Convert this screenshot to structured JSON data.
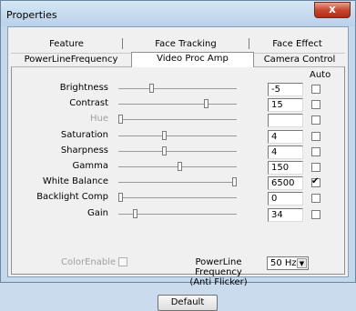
{
  "window": {
    "title": "Properties",
    "close_glyph": "x"
  },
  "tabs_row1": [
    "Feature",
    "Face Tracking",
    "Face Effect"
  ],
  "tabs_row2": [
    "PowerLineFrequency",
    "Video Proc Amp",
    "Camera Control"
  ],
  "active_tab": "Video Proc Amp",
  "auto_header": "Auto",
  "controls": [
    {
      "label": "Brightness",
      "value": "-5",
      "level": 0.27,
      "auto": false,
      "enabled": true
    },
    {
      "label": "Contrast",
      "value": "15",
      "level": 0.75,
      "auto": false,
      "enabled": true
    },
    {
      "label": "Hue",
      "value": "",
      "level": 0.0,
      "auto": false,
      "enabled": false
    },
    {
      "label": "Saturation",
      "value": "4",
      "level": 0.38,
      "auto": false,
      "enabled": true
    },
    {
      "label": "Sharpness",
      "value": "4",
      "level": 0.38,
      "auto": false,
      "enabled": true
    },
    {
      "label": "Gamma",
      "value": "150",
      "level": 0.52,
      "auto": false,
      "enabled": true
    },
    {
      "label": "White Balance",
      "value": "6500",
      "level": 1.0,
      "auto": true,
      "enabled": true
    },
    {
      "label": "Backlight Comp",
      "value": "0",
      "level": 0.0,
      "auto": false,
      "enabled": true
    },
    {
      "label": "Gain",
      "value": "34",
      "level": 0.13,
      "auto": false,
      "enabled": true
    }
  ],
  "color_enable": {
    "label": "ColorEnable",
    "checked": false
  },
  "powerline": {
    "label_line1": "PowerLine Frequency",
    "label_line2": "(Anti Flicker)",
    "selected": "50 Hz"
  },
  "default_button": "Default"
}
